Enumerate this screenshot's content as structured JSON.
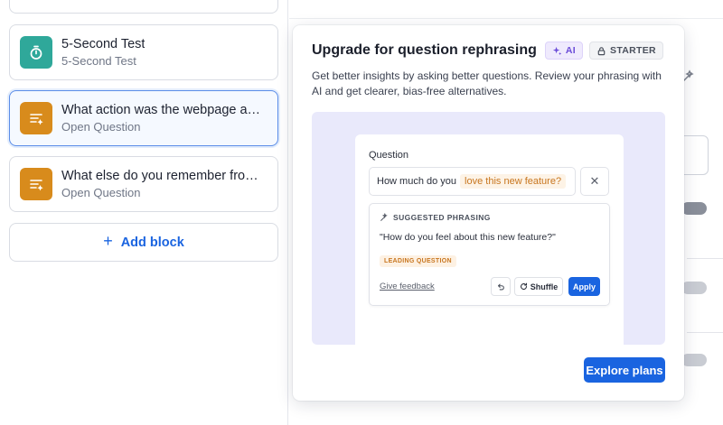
{
  "blocks": [
    {
      "title": "",
      "subtitle": "",
      "icon": "list-icon",
      "color": "#d88b1c"
    },
    {
      "title": "5-Second Test",
      "subtitle": "5-Second Test",
      "icon": "timer-icon",
      "color": "#2fa89a"
    },
    {
      "title": "What action was the webpage asking you to do?",
      "subtitle": "Open Question",
      "icon": "open-question-icon",
      "color": "#d88b1c"
    },
    {
      "title": "What else do you remember from the webpage?",
      "subtitle": "Open Question",
      "icon": "open-question-icon",
      "color": "#d88b1c"
    }
  ],
  "add_block": {
    "label": "Add block"
  },
  "popover": {
    "title": "Upgrade for question rephrasing",
    "ai_badge": "AI",
    "plan_badge": "STARTER",
    "description": "Get better insights by asking better questions. Review your phrasing with AI and get clearer, bias-free alternatives.",
    "explore_button": "Explore plans"
  },
  "illustration": {
    "question_label": "Question",
    "input_prefix": "How much do you",
    "input_highlight": "love this new feature?",
    "suggest_heading": "SUGGESTED PHRASING",
    "suggest_text": "\"How do you feel about this new feature?\"",
    "tag": "LEADING QUESTION",
    "feedback_link": "Give feedback",
    "shuffle_button": "Shuffle",
    "apply_button": "Apply"
  },
  "colors": {
    "accent": "#1a64e0",
    "ai_purple": "#6a4bd8",
    "warning_orange": "#c8761f"
  }
}
